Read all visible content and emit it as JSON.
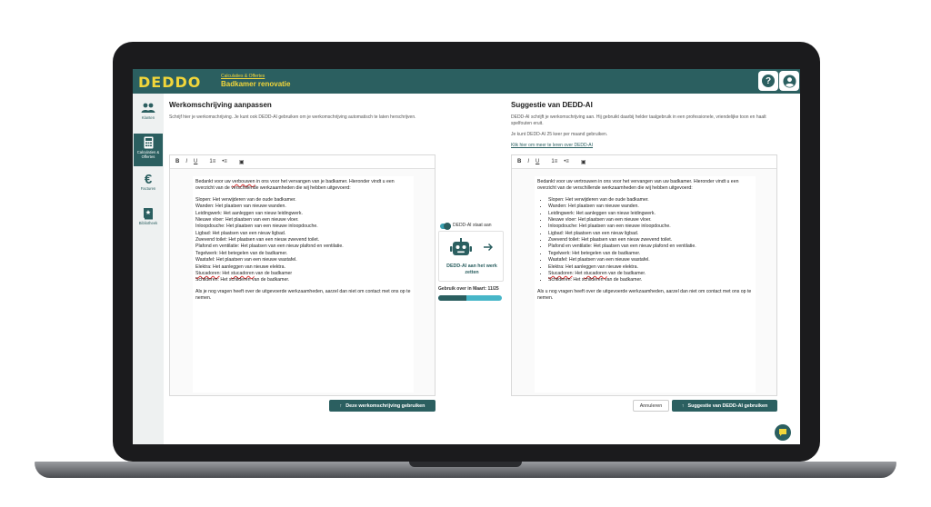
{
  "app": {
    "logo": "DEDDO",
    "breadcrumb": "Calculaties & Offertes",
    "title": "Badkamer renovatie"
  },
  "topbar": {
    "help_icon": "help-icon",
    "account_icon": "account-icon",
    "help_label": "?"
  },
  "sidebar": {
    "items": [
      {
        "label": "Klanten",
        "icon": "people-icon",
        "active": false
      },
      {
        "label": "Calculaties & Offertes",
        "icon": "calculator-icon",
        "active": true
      },
      {
        "label": "Facturen",
        "icon": "euro-icon",
        "active": false
      },
      {
        "label": "Bibliotheek",
        "icon": "book-icon",
        "active": false
      }
    ]
  },
  "left": {
    "heading": "Werkomschrijving aanpassen",
    "description": "Schrijf hier je werkomschrijving. Je kunt ook DEDD-AI gebruiken om je werkomschrijving automatisch te laten herschrijven.",
    "toolbar": {
      "bold": "B",
      "italic": "I",
      "underline": "U",
      "ordered_list": "1≡",
      "bullet_list": "•≡",
      "image": "▣"
    },
    "intro_a": "Bedankt voor uw ",
    "intro_err": "verbouwen",
    "intro_b": " in ons voor het vervangen van je badkamer. Hieronder vindt u een overzicht van de verschillende werkzaamheden die wij hebben uitgevoerd:",
    "lines": [
      "Slopen: Het verwijderen van de oude badkamer.",
      "Wanden: Het plaatsen van nieuwe wanden.",
      "Leidingwerk: Het aanleggen van nieuw leidingwerk.",
      "Nieuwe vloer: Het plaatsen van een nieuwe vloer.",
      "Inloopdouche: Het plaatsen van een nieuwe inloopdouche.",
      "Ligbad: Het plaatsen van een nieuw ligbad.",
      "Zwevend toilet: Het plaatsen van een nieuw zwevend toilet.",
      "Plafond en ventilatie: Het plaatsen van een nieuw plafond en ventilatie.",
      "Tegelwerk: Het betegelen van de badkamer.",
      "Wastafel: Het plaatsen van een nieuwe wastafel.",
      "Elektra: Het aanleggen van nieuwe elektra."
    ],
    "stuc_a": "Stucadoren",
    "stuc_b": ": Het ",
    "stuc_c": "stucadoren",
    "stuc_d": " van de badkamer",
    "last_line": "Schilderen: Het schilderen van de badkamer.",
    "closing": "Als je nog vragen heeft over de uitgevoerde werkzaamheden, aarzel dan niet om contact met ons op te nemen.",
    "use_button": "Deze werkomschrijving gebruiken"
  },
  "ai": {
    "status_label": "DEDD-AI staat aan",
    "card_label": "DEDD-AI aan het werk zetten",
    "usage_label": "Gebruik over in Maart: 11/25",
    "usage_fraction": 0.44
  },
  "right": {
    "heading": "Suggestie van DEDD-AI",
    "description": "DEDD-AI schrijft je werkomschrijving aan. Hij gebruikt daarbij helder taalgebruik in een professionele, vriendelijke toon en haalt spelfouten eruit.",
    "limit_text": "Je kunt DEDD-AI 25 keer per maand gebruiken.",
    "learn_link": "Klik hier om meer te leren over DEDD-AI",
    "toolbar": {
      "bold": "B",
      "italic": "I",
      "underline": "U",
      "ordered_list": "1≡",
      "bullet_list": "•≡",
      "image": "▣"
    },
    "intro": "Bedankt voor uw vertrouwen in ons voor het vervangen van uw badkamer. Hieronder vindt u een overzicht van de verschillende werkzaamheden die wij hebben uitgevoerd:",
    "items": [
      "Slopen: Het verwijderen van de oude badkamer.",
      "Wanden: Het plaatsen van nieuwe wanden.",
      "Leidingwerk: Het aanleggen van nieuw leidingwerk.",
      "Nieuwe vloer: Het plaatsen van een nieuwe vloer.",
      "Inloopdouche: Het plaatsen van een nieuwe inloopdouche.",
      "Ligbad: Het plaatsen van een nieuw ligbad.",
      "Zwevend toilet: Het plaatsen van een nieuw zwevend toilet.",
      "Plafond en ventilatie: Het plaatsen van een nieuw plafond en ventilatie.",
      "Tegelwerk: Het betegelen van de badkamer.",
      "Wastafel: Het plaatsen van een nieuwe wastafel.",
      "Elektra: Het aanleggen van nieuwe elektra."
    ],
    "stuc_a": "Stucadoren",
    "stuc_b": ": Het ",
    "stuc_c": "stucadoren",
    "stuc_d": " van de badkamer.",
    "last_item": "Schilderen: Het schilderen van de badkamer.",
    "closing": "Als u nog vragen heeft over de uitgevoerde werkzaamheden, aarzel dan niet om contact met ons op te nemen.",
    "cancel_button": "Annuleren",
    "use_button": "Suggestie van DEDD-AI gebruiken"
  },
  "colors": {
    "brand": "#2b5f60",
    "accent": "#f2d63a",
    "progress": "#47b6c8"
  },
  "chat": {
    "icon": "chat-icon"
  }
}
